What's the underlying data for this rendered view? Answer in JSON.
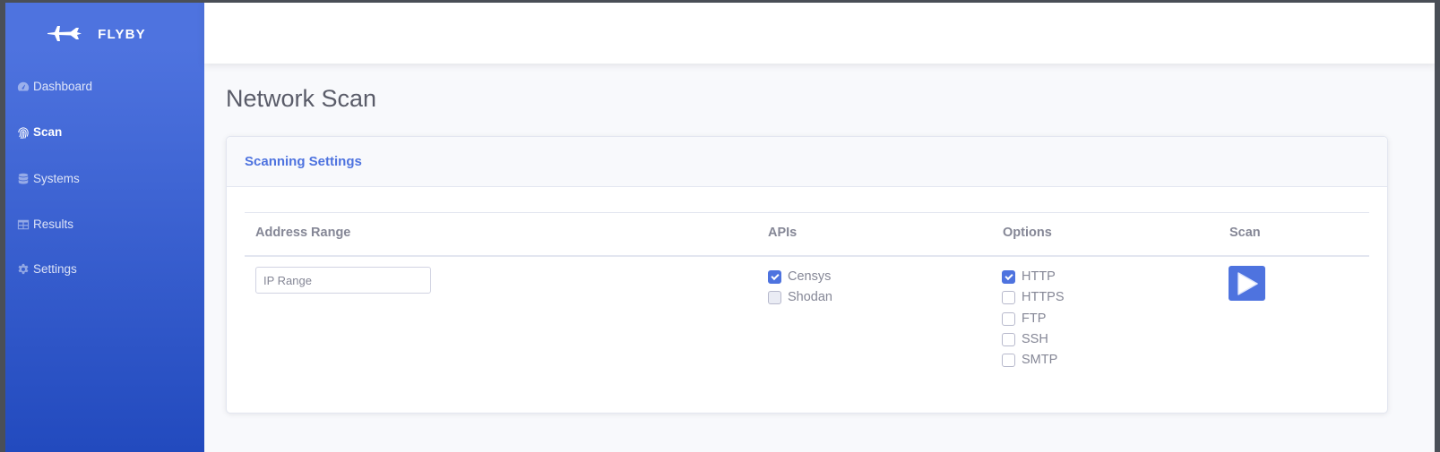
{
  "sidebar": {
    "brand": "FLYBY",
    "items": [
      {
        "label": "Dashboard",
        "icon": "tachometer-icon",
        "active": false
      },
      {
        "label": "Scan",
        "icon": "fingerprint-icon",
        "active": true
      },
      {
        "label": "Systems",
        "icon": "database-icon",
        "active": false
      },
      {
        "label": "Results",
        "icon": "table-icon",
        "active": false
      },
      {
        "label": "Settings",
        "icon": "gear-icon",
        "active": false
      }
    ]
  },
  "page": {
    "title": "Network Scan"
  },
  "card": {
    "title": "Scanning Settings",
    "columns": [
      "Address Range",
      "APIs",
      "Options",
      "Scan"
    ],
    "ip_input": {
      "placeholder": "IP Range",
      "value": ""
    },
    "apis": [
      {
        "label": "Censys",
        "checked": true
      },
      {
        "label": "Shodan",
        "checked": false
      }
    ],
    "options": [
      {
        "label": "HTTP",
        "checked": true
      },
      {
        "label": "HTTPS",
        "checked": false
      },
      {
        "label": "FTP",
        "checked": false
      },
      {
        "label": "SSH",
        "checked": false
      },
      {
        "label": "SMTP",
        "checked": false
      }
    ]
  },
  "colors": {
    "primary": "#4e73df",
    "primary_dark": "#224abe",
    "text_muted": "#858796",
    "heading": "#5a5c69",
    "background": "#f8f9fc"
  }
}
